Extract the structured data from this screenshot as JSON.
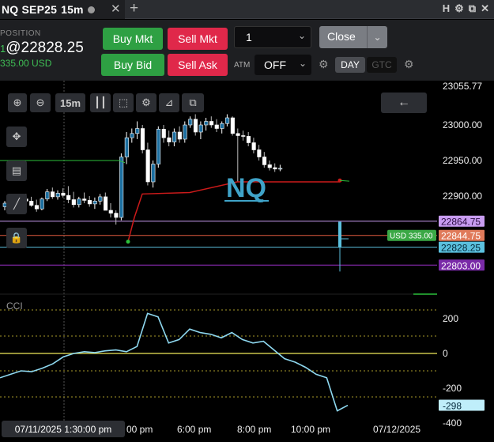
{
  "tab": {
    "title": "NQ SEP25",
    "interval": "15m",
    "window_icons": [
      "H",
      "gear-icon",
      "undock-icon",
      "close-icon"
    ]
  },
  "position": {
    "label": "POSITION",
    "qty": "1",
    "price": "@22828.25",
    "usd": "335.00 USD"
  },
  "buttons": {
    "buy_mkt": "Buy Mkt",
    "sell_mkt": "Sell Mkt",
    "buy_bid": "Buy Bid",
    "sell_ask": "Sell Ask",
    "close": "Close",
    "day": "DAY",
    "gtc": "GTC"
  },
  "quantity": {
    "value": "1"
  },
  "atm": {
    "label": "ATM",
    "value": "OFF"
  },
  "colors": {
    "up": "#ffffff",
    "down": "#ffffff",
    "trend_red": "#cc1a1a",
    "ma_green": "#2bbf3a",
    "cci": "#8ed8f0",
    "symbol": "#3fa3c8",
    "position_line": "#e05a40",
    "entry_line": "#5bc0de",
    "purple": "#9b30c8",
    "lilac": "#c89cf0"
  },
  "toolbar": {
    "interval_label": "15m",
    "icons": [
      "zoom-in-icon",
      "zoom-out-icon",
      "candles-icon",
      "crosshair-box-icon",
      "gear-icon",
      "ruler-icon",
      "copy-icon"
    ]
  },
  "chart_data": {
    "type": "candlestick",
    "symbol_label": "NQ",
    "indicator_label": "CCI",
    "price_ticks": [
      "23000.00",
      "22950.00",
      "22900.00"
    ],
    "price_top_partial": "23055.77",
    "price_ylim": [
      22790,
      23060
    ],
    "level_tags": [
      {
        "label": "22864.75",
        "value": 22864.75,
        "kind": "lilac"
      },
      {
        "label": "22844.75",
        "value": 22844.75,
        "kind": "position"
      },
      {
        "label": "22828.25",
        "value": 22828.25,
        "kind": "entry"
      },
      {
        "label": "22803.00",
        "value": 22803.0,
        "kind": "purple"
      }
    ],
    "position_tag": "USD 335.00",
    "cci_ticks": [
      "200",
      "0",
      "-200",
      "-400"
    ],
    "cci_ylim": [
      -420,
      300
    ],
    "cci_current": "-298",
    "time_labels": [
      "00 pm",
      "6:00 pm",
      "8:00 pm",
      "10:00 pm",
      "07/12/2025"
    ],
    "cursor_time": "07/11/2025 1:30:00 pm",
    "candles": [
      [
        22885,
        22893,
        22880,
        22890
      ],
      [
        22890,
        22896,
        22883,
        22884
      ],
      [
        22884,
        22892,
        22878,
        22888
      ],
      [
        22888,
        22900,
        22885,
        22896
      ],
      [
        22896,
        22903,
        22890,
        22893
      ],
      [
        22893,
        22899,
        22885,
        22887
      ],
      [
        22887,
        22895,
        22878,
        22882
      ],
      [
        22882,
        22898,
        22880,
        22896
      ],
      [
        22896,
        22910,
        22893,
        22906
      ],
      [
        22906,
        22912,
        22896,
        22899
      ],
      [
        22899,
        22908,
        22895,
        22904
      ],
      [
        22904,
        22911,
        22898,
        22901
      ],
      [
        22901,
        22914,
        22890,
        22895
      ],
      [
        22895,
        22906,
        22884,
        22888
      ],
      [
        22888,
        22899,
        22884,
        22896
      ],
      [
        22896,
        22905,
        22890,
        22894
      ],
      [
        22894,
        22900,
        22885,
        22889
      ],
      [
        22889,
        22898,
        22882,
        22893
      ],
      [
        22893,
        22903,
        22888,
        22899
      ],
      [
        22899,
        22905,
        22884,
        22880
      ],
      [
        22880,
        22890,
        22870,
        22876
      ],
      [
        22876,
        22880,
        22860,
        22870
      ],
      [
        22870,
        22960,
        22866,
        22955
      ],
      [
        22955,
        22990,
        22945,
        22982
      ],
      [
        22982,
        22995,
        22975,
        22988
      ],
      [
        22988,
        23005,
        22980,
        22995
      ],
      [
        22995,
        23000,
        22960,
        22965
      ],
      [
        22965,
        22975,
        22915,
        22920
      ],
      [
        22920,
        22950,
        22912,
        22945
      ],
      [
        22945,
        22998,
        22940,
        22994
      ],
      [
        22994,
        23000,
        22975,
        22982
      ],
      [
        22982,
        22992,
        22970,
        22976
      ],
      [
        22976,
        22995,
        22970,
        22990
      ],
      [
        22990,
        22998,
        22975,
        22980
      ],
      [
        22980,
        23005,
        22975,
        23000
      ],
      [
        23000,
        23012,
        22996,
        23008
      ],
      [
        23008,
        23015,
        22985,
        22990
      ],
      [
        22990,
        23005,
        22980,
        23000
      ],
      [
        23000,
        23010,
        22992,
        23005
      ],
      [
        23005,
        23012,
        22996,
        23000
      ],
      [
        23000,
        23008,
        22990,
        22995
      ],
      [
        22995,
        23005,
        22988,
        23002
      ],
      [
        23002,
        23015,
        22998,
        23010
      ],
      [
        23010,
        23012,
        22985,
        22988
      ],
      [
        22988,
        22995,
        22920,
        22985
      ],
      [
        22985,
        22992,
        22978,
        22984
      ],
      [
        22984,
        22990,
        22970,
        22975
      ],
      [
        22975,
        22982,
        22960,
        22965
      ],
      [
        22965,
        22972,
        22950,
        22955
      ],
      [
        22955,
        22962,
        22940,
        22944
      ],
      [
        22944,
        22950,
        22936,
        22940
      ],
      [
        22940,
        22946,
        22934,
        22938
      ],
      [
        22938,
        22944,
        22935,
        22939
      ]
    ],
    "cci_values": [
      -140,
      -120,
      -100,
      -105,
      -85,
      -60,
      -20,
      0,
      10,
      5,
      15,
      20,
      10,
      40,
      230,
      210,
      60,
      80,
      140,
      120,
      110,
      90,
      120,
      80,
      60,
      70,
      20,
      -30,
      -50,
      -80,
      -120,
      -140,
      -330,
      -298
    ]
  }
}
